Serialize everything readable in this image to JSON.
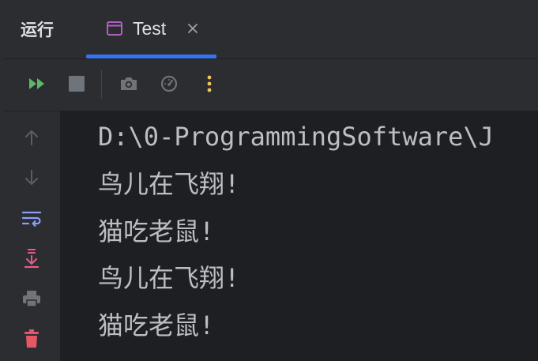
{
  "panel": {
    "title": "运行"
  },
  "tab": {
    "label": "Test",
    "icon": "run-config-window-icon",
    "accent_color": "#3574f0",
    "icon_color": "#b05fc3"
  },
  "toolbar": {
    "buttons": [
      {
        "name": "rerun-button",
        "icon": "rerun-icon",
        "color": "#5fb865"
      },
      {
        "name": "stop-button",
        "icon": "stop-icon",
        "color": "#6f737a"
      },
      {
        "name": "dump-threads-button",
        "icon": "camera-icon",
        "color": "#6f737a"
      },
      {
        "name": "profiler-button",
        "icon": "gauge-icon",
        "color": "#6f737a"
      },
      {
        "name": "more-options-button",
        "icon": "more-vertical-icon",
        "color": "#f2c55c"
      }
    ]
  },
  "sidebar": {
    "buttons": [
      {
        "name": "scroll-up-button",
        "icon": "arrow-up-icon",
        "color": "#5a5d63"
      },
      {
        "name": "scroll-down-button",
        "icon": "arrow-down-icon",
        "color": "#5a5d63"
      },
      {
        "name": "soft-wrap-button",
        "icon": "soft-wrap-icon",
        "color": "#8c9efc"
      },
      {
        "name": "scroll-to-end-button",
        "icon": "scroll-to-end-icon",
        "color": "#e55e8a"
      },
      {
        "name": "print-button",
        "icon": "printer-icon",
        "color": "#6f737a"
      },
      {
        "name": "clear-all-button",
        "icon": "trash-icon",
        "color": "#e55765"
      }
    ]
  },
  "console": {
    "lines": [
      "D:\\0-ProgrammingSoftware\\J",
      "鸟儿在飞翔!",
      "猫吃老鼠!",
      "鸟儿在飞翔!",
      "猫吃老鼠!"
    ],
    "text_color": "#bcbec4"
  }
}
